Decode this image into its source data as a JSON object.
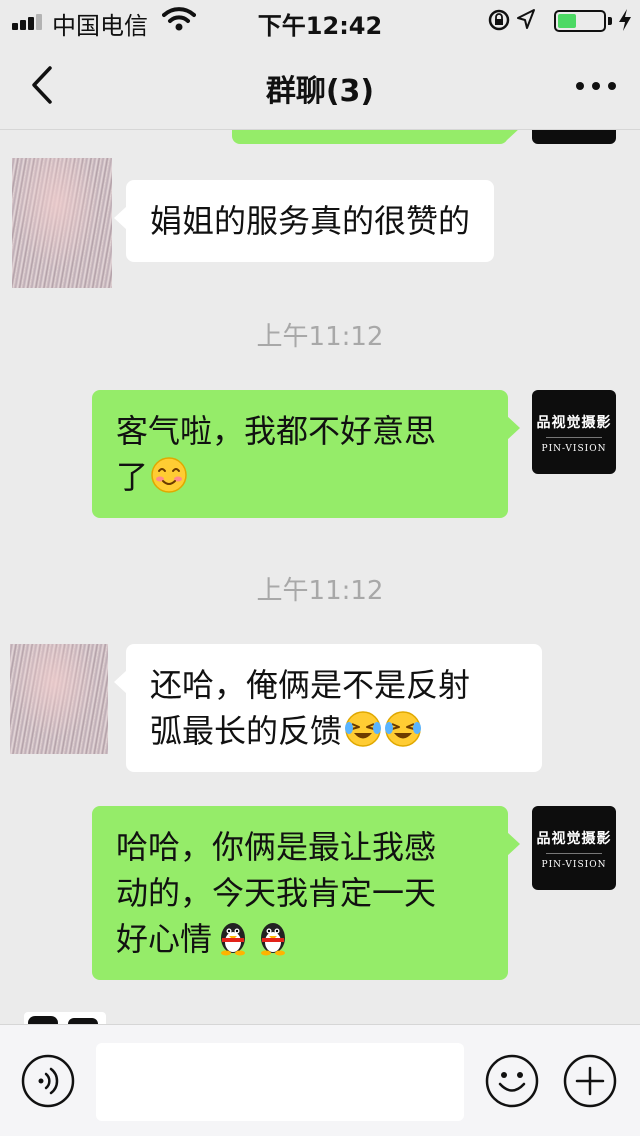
{
  "status_bar": {
    "carrier": "中国电信",
    "time": "下午12:42",
    "battery_level": 0.4,
    "charging": true
  },
  "nav": {
    "title": "群聊(3)"
  },
  "chat": {
    "messages": [
      {
        "type": "text",
        "side": "left",
        "text": "娟姐的服务真的很赞的"
      },
      {
        "type": "time",
        "text": "上午11:12"
      },
      {
        "type": "text",
        "side": "right",
        "lines": [
          "客气啦，我都不好意思",
          "了"
        ],
        "emojis": [
          "blushing-smile-emoji"
        ]
      },
      {
        "type": "time",
        "text": "上午11:12"
      },
      {
        "type": "text",
        "side": "left",
        "lines": [
          "还哈，俺俩是不是反射",
          "弧最长的反馈"
        ],
        "emojis": [
          "crying-laughing-emoji",
          "crying-laughing-emoji"
        ]
      },
      {
        "type": "text",
        "side": "right",
        "lines": [
          "哈哈，你俩是最让我感",
          "动的，今天我肯定一天",
          "好心情"
        ],
        "emojis": [
          "penguin-emoji",
          "penguin-emoji"
        ]
      }
    ],
    "brand_avatar": {
      "name_cn": "品视觉摄影",
      "name_en": "PIN-VISION"
    }
  },
  "input_bar": {
    "placeholder": "",
    "icons": [
      "voice-icon",
      "emoji-face-icon",
      "plus-icon"
    ]
  },
  "colors": {
    "background": "#ebebeb",
    "outgoing_bubble": "#95ec69",
    "incoming_bubble": "#ffffff",
    "timestamp_text": "#a8a8a8",
    "battery_fill": "#4cd964"
  }
}
